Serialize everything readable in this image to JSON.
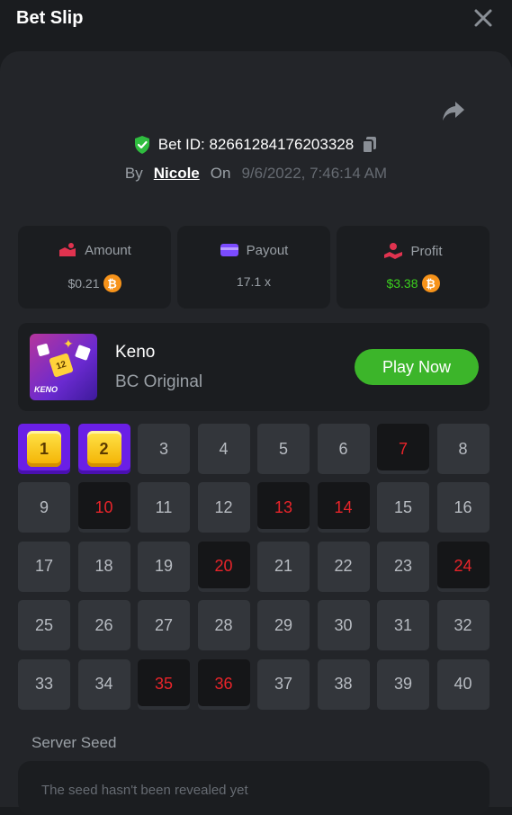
{
  "header": {
    "title": "Bet Slip",
    "close_icon": "close-icon"
  },
  "bet": {
    "id_label": "Bet ID: 82661284176203328",
    "by_label": "By",
    "user": "Nicole",
    "on_label": "On",
    "date": "9/6/2022, 7:46:14 AM"
  },
  "stats": {
    "amount": {
      "label": "Amount",
      "value": "$0.21",
      "icon": "amount-icon",
      "color": "#e0334f"
    },
    "payout": {
      "label": "Payout",
      "value": "17.1 x",
      "icon": "card-icon",
      "color": "#7b4bff"
    },
    "profit": {
      "label": "Profit",
      "value": "$3.38",
      "icon": "profit-icon",
      "color": "#e0334f",
      "value_color": "#3cd11e"
    }
  },
  "game": {
    "name": "Keno",
    "subtitle": "BC Original",
    "thumb_text": "KENO",
    "thumb_tile": "12",
    "play_label": "Play Now"
  },
  "keno": {
    "numbers": [
      "1",
      "2",
      "3",
      "4",
      "5",
      "6",
      "7",
      "8",
      "9",
      "10",
      "11",
      "12",
      "13",
      "14",
      "15",
      "16",
      "17",
      "18",
      "19",
      "20",
      "21",
      "22",
      "23",
      "24",
      "25",
      "26",
      "27",
      "28",
      "29",
      "30",
      "31",
      "32",
      "33",
      "34",
      "35",
      "36",
      "37",
      "38",
      "39",
      "40"
    ],
    "picked": [
      "1",
      "2"
    ],
    "hits": [
      "7",
      "10",
      "13",
      "14",
      "20",
      "24",
      "35",
      "36"
    ]
  },
  "seed": {
    "label": "Server Seed",
    "value": "The seed hasn't been revealed yet"
  },
  "colors": {
    "accent_green": "#3cb52a",
    "hit_red": "#e8242a",
    "pick_purple": "#6a1fe6",
    "coin": "#f7931a"
  }
}
